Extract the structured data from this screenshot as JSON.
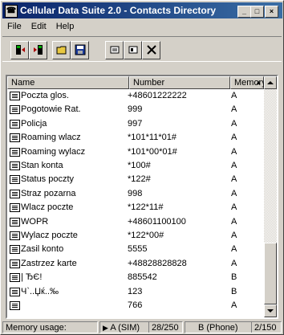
{
  "window": {
    "title": "Cellular Data Suite 2.0 - Contacts Directory",
    "controls": [
      "_",
      "□",
      "×"
    ]
  },
  "menu": [
    "File",
    "Edit",
    "Help"
  ],
  "toolbar": {
    "buttons": [
      "phone-to-pc-icon",
      "pc-to-phone-icon",
      "open-folder-icon",
      "save-icon",
      "new-contact-icon",
      "edit-contact-icon",
      "delete-icon"
    ]
  },
  "list": {
    "columns": {
      "name": "Name",
      "number": "Number",
      "memory": "Memory"
    },
    "rows": [
      {
        "name": "Poczta glos.",
        "number": "+48601222222",
        "memory": "A"
      },
      {
        "name": "Pogotowie Rat.",
        "number": "999",
        "memory": "A"
      },
      {
        "name": "Policja",
        "number": "997",
        "memory": "A"
      },
      {
        "name": "Roaming wlacz",
        "number": "*101*11*01#",
        "memory": "A"
      },
      {
        "name": "Roaming wylacz",
        "number": "*101*00*01#",
        "memory": "A"
      },
      {
        "name": "Stan konta",
        "number": "*100#",
        "memory": "A"
      },
      {
        "name": "Status poczty",
        "number": "*122#",
        "memory": "A"
      },
      {
        "name": "Straz pozarna",
        "number": "998",
        "memory": "A"
      },
      {
        "name": "Wlacz poczte",
        "number": "*122*11#",
        "memory": "A"
      },
      {
        "name": "WOPR",
        "number": "+48601100100",
        "memory": "A"
      },
      {
        "name": "Wylacz poczte",
        "number": "*122*00#",
        "memory": "A"
      },
      {
        "name": "Zasil konto",
        "number": "5555",
        "memory": "A"
      },
      {
        "name": "Zastrzez karte",
        "number": "+48828828828",
        "memory": "A"
      },
      {
        "name": "| ЂЄ!",
        "number": "885542",
        "memory": "B"
      },
      {
        "name": "Ч`..Џќ..‰",
        "number": "123",
        "memory": "B"
      },
      {
        "name": "",
        "number": "766",
        "memory": "A"
      }
    ]
  },
  "status": {
    "label": "Memory usage:",
    "sim_label": "A (SIM)",
    "sim_usage": "28/250",
    "phone_label": "B (Phone)",
    "phone_usage": "2/150"
  }
}
